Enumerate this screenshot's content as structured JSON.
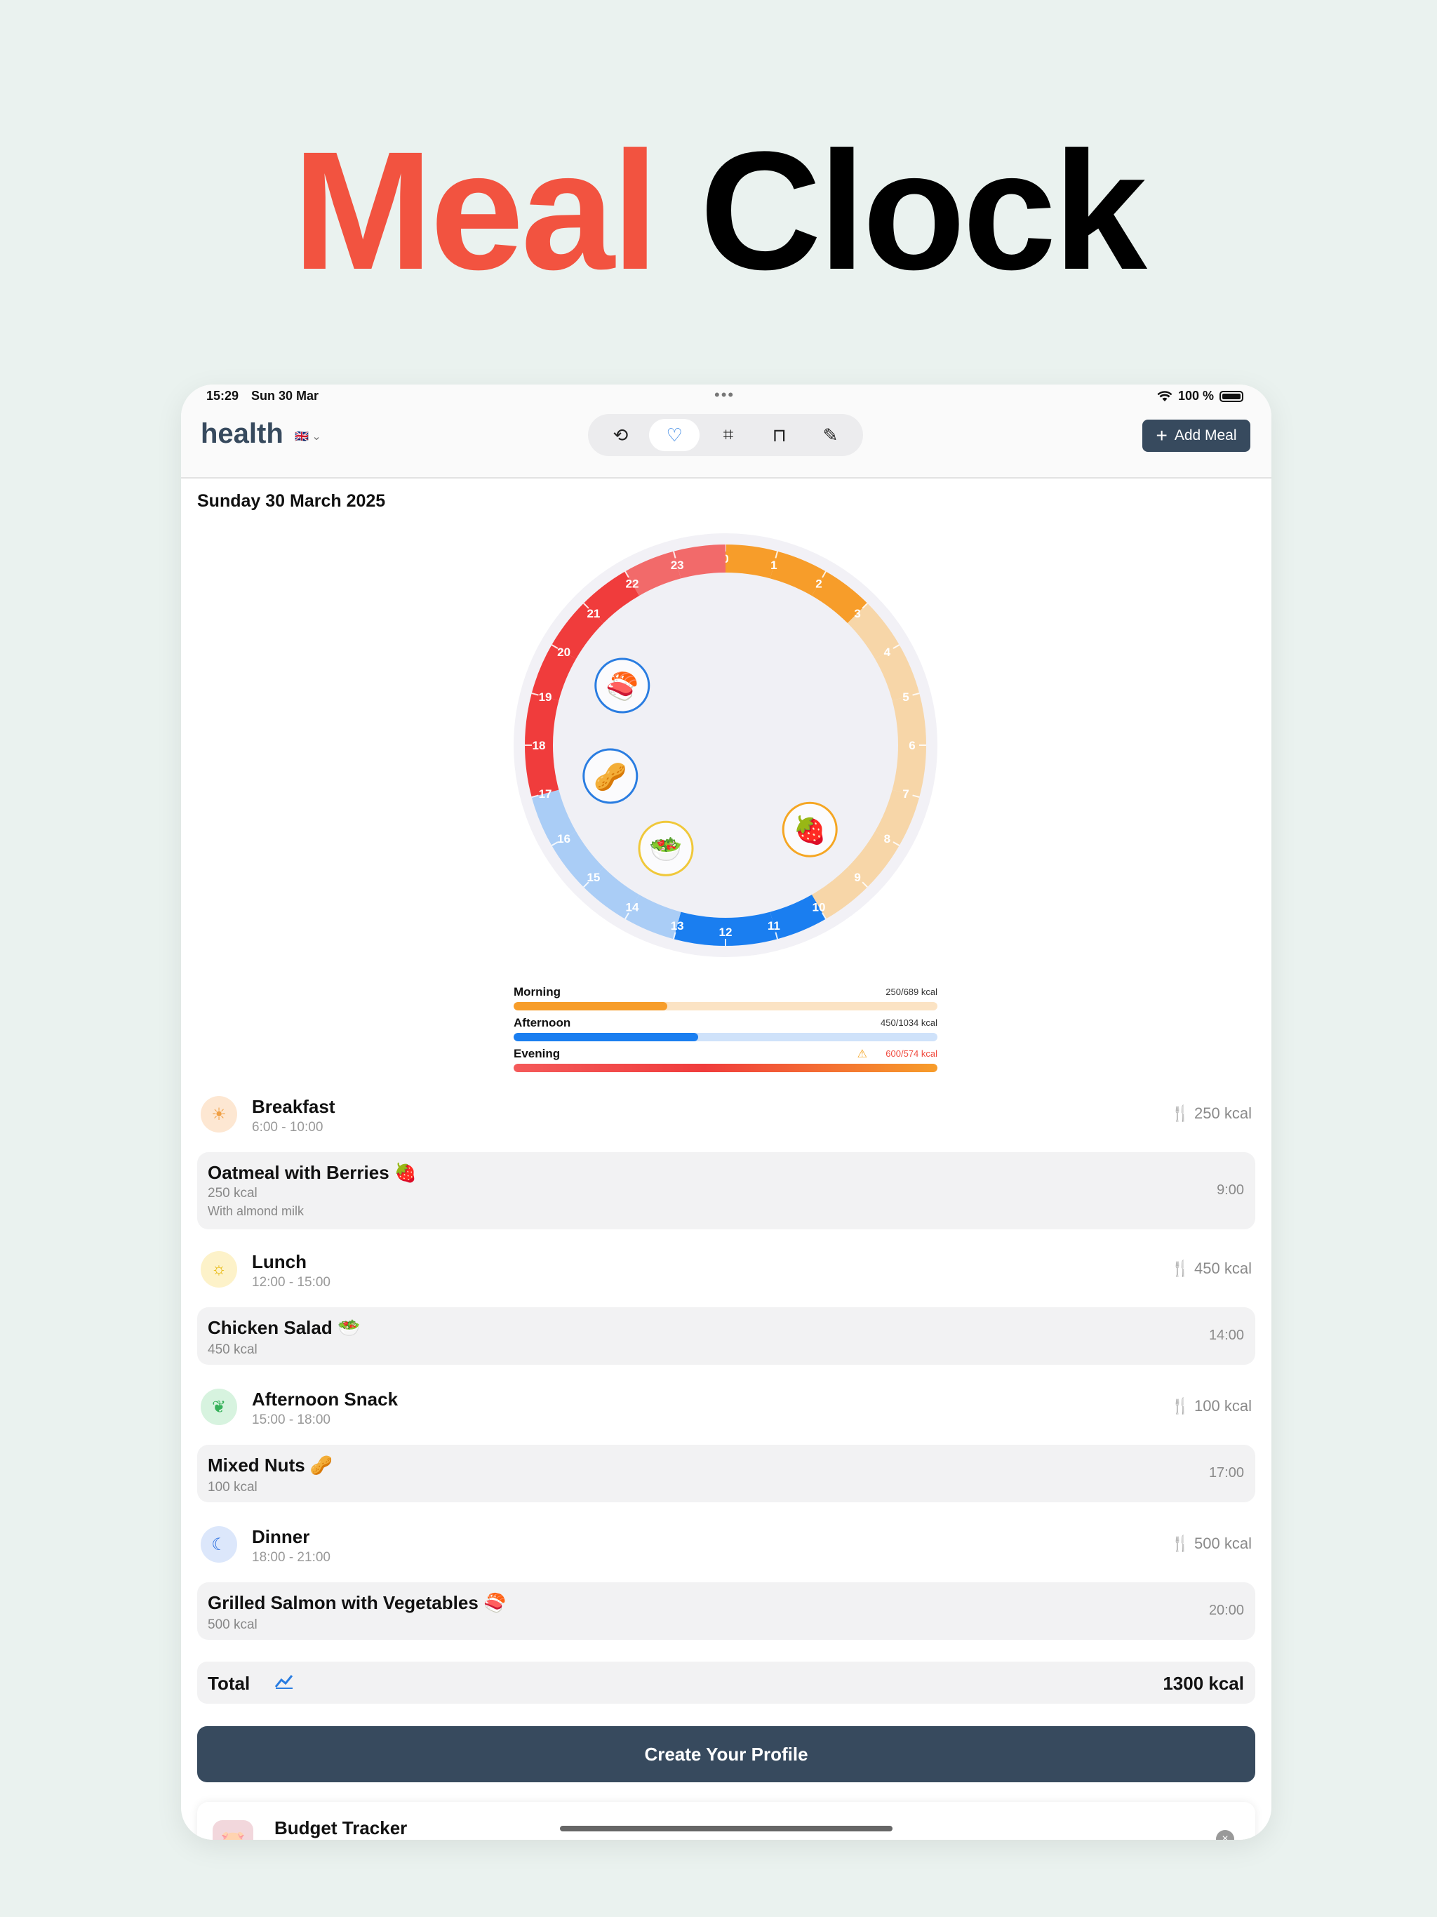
{
  "headline": {
    "word1": "Meal",
    "word2": "Clock"
  },
  "status": {
    "time": "15:29",
    "date": "Sun 30 Mar",
    "dots": "•••",
    "wifi": "wifi-icon",
    "battery": "100 %"
  },
  "app": {
    "brand": "health",
    "flag": "🇬🇧 ⌄",
    "add_meal": "Add Meal"
  },
  "tabs": [
    {
      "name": "history-icon",
      "glyph": "⟲"
    },
    {
      "name": "heart-icon",
      "glyph": "♡"
    },
    {
      "name": "scan-icon",
      "glyph": "⌗"
    },
    {
      "name": "scale-icon",
      "glyph": "⊓"
    },
    {
      "name": "carrot-icon",
      "glyph": "✎"
    }
  ],
  "date_heading": "Sunday 30 March 2025",
  "clock": {
    "hours": [
      "0",
      "1",
      "2",
      "3",
      "4",
      "5",
      "6",
      "7",
      "8",
      "9",
      "10",
      "11",
      "12",
      "13",
      "14",
      "15",
      "16",
      "17",
      "18",
      "19",
      "20",
      "21",
      "22",
      "23"
    ],
    "colors": {
      "morning": "#f79d2a",
      "morning_light": "#f7d6a8",
      "midday": "#1a7ef0",
      "afternoon": "#aacdf6",
      "evening": "#f03c3c",
      "night": "#f26a6a"
    },
    "meals_on_clock": [
      {
        "name": "strawberry-marker",
        "emoji": "🍓",
        "hour": 9,
        "ring": "#f5a623"
      },
      {
        "name": "salad-marker",
        "emoji": "🥗",
        "hour": 14,
        "ring": "#f0c83a"
      },
      {
        "name": "nuts-marker",
        "emoji": "🥜",
        "hour": 17,
        "ring": "#2a7de1"
      },
      {
        "name": "salmon-marker",
        "emoji": "🍣",
        "hour": 20,
        "ring": "#2a7de1"
      }
    ]
  },
  "progress": [
    {
      "label": "Morning",
      "value": "250/689 kcal",
      "fraction": 0.363,
      "color": "#f79d2a",
      "track": "#fbe3c4"
    },
    {
      "label": "Afternoon",
      "value": "450/1034 kcal",
      "fraction": 0.435,
      "color": "#1a7ef0",
      "track": "#cfe2fa"
    },
    {
      "label": "Evening",
      "value": "600/574 kcal",
      "fraction": 1.0,
      "color": "#f04a3e",
      "track": "#fbd1cd",
      "warning": "⚠"
    }
  ],
  "sections": [
    {
      "name": "Breakfast",
      "time": "6:00 - 10:00",
      "kcal": "🍴 250 kcal",
      "icon": "☀",
      "icon_bg": "#fde7d2",
      "icon_color": "#f0a045",
      "meal": {
        "name": "Oatmeal with Berries 🍓",
        "kcal": "250 kcal",
        "note": "With almond milk",
        "time": "9:00"
      }
    },
    {
      "name": "Lunch",
      "time": "12:00 - 15:00",
      "kcal": "🍴 450 kcal",
      "icon": "☼",
      "icon_bg": "#fdf2c9",
      "icon_color": "#e6b400",
      "meal": {
        "name": "Chicken Salad 🥗",
        "kcal": "450 kcal",
        "note": "",
        "time": "14:00"
      }
    },
    {
      "name": "Afternoon Snack",
      "time": "15:00 - 18:00",
      "kcal": "🍴 100 kcal",
      "icon": "❦",
      "icon_bg": "#d7f3df",
      "icon_color": "#37b15a",
      "meal": {
        "name": "Mixed Nuts 🥜",
        "kcal": "100 kcal",
        "note": "",
        "time": "17:00"
      }
    },
    {
      "name": "Dinner",
      "time": "18:00 - 21:00",
      "kcal": "🍴 500 kcal",
      "icon": "☾",
      "icon_bg": "#dce7fb",
      "icon_color": "#2a6fe0",
      "meal": {
        "name": "Grilled Salmon with Vegetables 🍣",
        "kcal": "500 kcal",
        "note": "",
        "time": "20:00"
      }
    }
  ],
  "total": {
    "label": "Total",
    "icon": "chart-icon",
    "value": "1300 kcal"
  },
  "cta": "Create Your Profile",
  "budget": {
    "name": "Budget Tracker",
    "icon": "🐷",
    "close": "×"
  }
}
